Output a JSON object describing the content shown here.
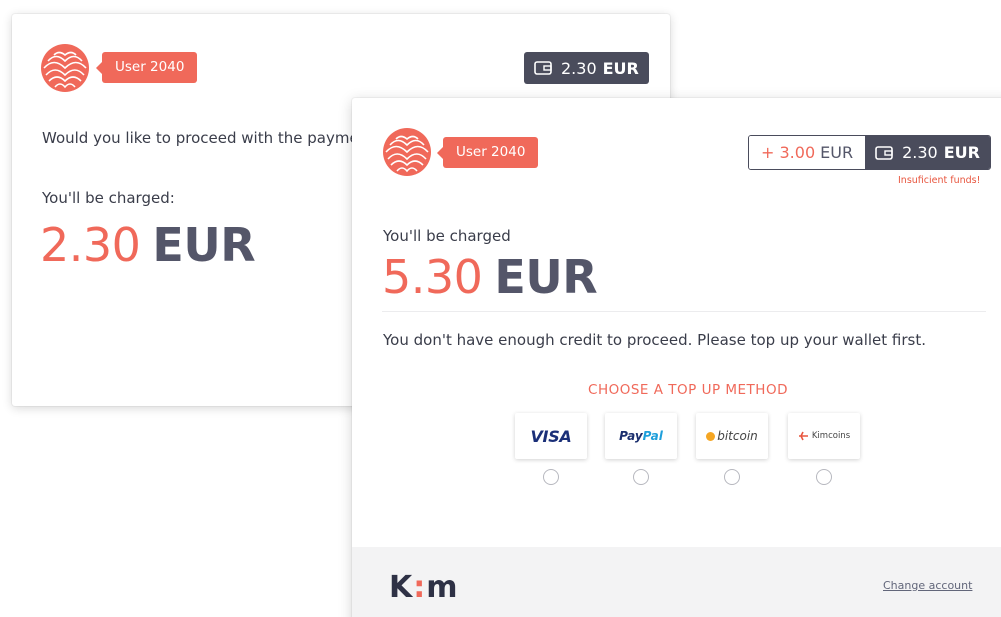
{
  "back_card": {
    "user": "User 2040",
    "wallet": {
      "amount": "2.30",
      "currency": "EUR"
    },
    "question": "Would you like to proceed with the payme",
    "charge_label": "You'll be charged:",
    "charge_amount": "2.30",
    "charge_currency": "EUR"
  },
  "front_card": {
    "user": "User 2040",
    "topup": {
      "amount": "+ 3.00",
      "currency": "EUR"
    },
    "wallet": {
      "amount": "2.30",
      "currency": "EUR"
    },
    "insufficient_text": "Insuficient funds!",
    "charge_label": "You'll be charged",
    "charge_amount": "5.30",
    "charge_currency": "EUR",
    "message": "You don't have enough credit to proceed. Please top up your wallet first.",
    "choose_title": "CHOOSE A TOP UP METHOD",
    "methods": [
      {
        "name": "VISA",
        "icon": "visa-logo"
      },
      {
        "name_part1": "Pay",
        "name_part2": "Pal",
        "icon": "paypal-logo"
      },
      {
        "name": "bitcoin",
        "icon": "bitcoin-logo"
      },
      {
        "name": "Kimcoins",
        "icon": "kimcoins-logo"
      }
    ],
    "footer": {
      "brand_k": "K",
      "brand_colon": ":",
      "brand_m": "m",
      "change_account": "Change account"
    }
  },
  "colors": {
    "accent": "#f0695a",
    "dark": "#4a4c5c",
    "text": "#3a3d4a",
    "error": "#e8563f"
  }
}
